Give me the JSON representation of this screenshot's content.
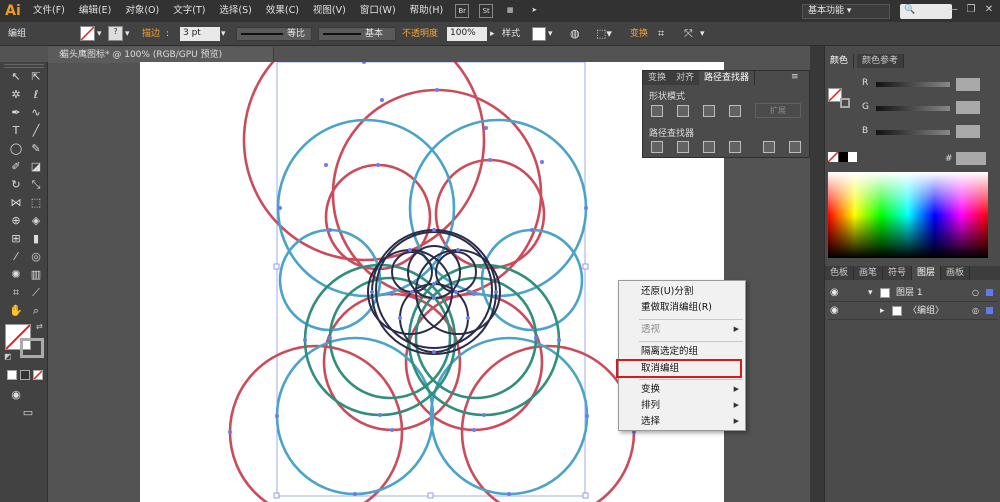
{
  "menubar": {
    "logo": "Ai",
    "items": [
      "文件(F)",
      "编辑(E)",
      "对象(O)",
      "文字(T)",
      "选择(S)",
      "效果(C)",
      "视图(V)",
      "窗口(W)",
      "帮助(H)"
    ],
    "badge": "Br",
    "badge2": "St",
    "workspace": "基本功能",
    "window_buttons": [
      "—",
      "❐",
      "✕"
    ]
  },
  "control_bar": {
    "selection": "编组",
    "stroke_label": "描边",
    "stroke_value": "3 pt",
    "profile_label": "等比",
    "brush_label": "基本",
    "opacity_label": "不透明度",
    "opacity_value": "100%",
    "style_label": "样式",
    "transform_label": "变换"
  },
  "document": {
    "tab_title": "猫头鹰图标* @ 100% (RGB/GPU 预览)",
    "close": "×"
  },
  "pathfinder": {
    "tabs": [
      "变换",
      "对齐",
      "路径查找器"
    ],
    "shape_modes_label": "形状模式",
    "pathfinders_label": "路径查找器",
    "expand_label": "扩展"
  },
  "color_panel": {
    "tabs": [
      "颜色",
      "颜色参考"
    ],
    "channels": [
      "R",
      "G",
      "B"
    ],
    "hex_label": "#"
  },
  "layers_panel": {
    "tabs": [
      "色板",
      "画笔",
      "符号",
      "图层",
      "画板"
    ],
    "rows": [
      {
        "name": "图层 1"
      },
      {
        "name": "〈编组〉"
      }
    ]
  },
  "context_menu": {
    "items": [
      {
        "label": "还原(U)分割",
        "enabled": true,
        "submenu": false
      },
      {
        "label": "重做取消编组(R)",
        "enabled": true,
        "submenu": false
      },
      {
        "label": "透视",
        "enabled": false,
        "submenu": true
      },
      {
        "label": "隔离选定的组",
        "enabled": true,
        "submenu": false
      },
      {
        "label": "取消编组",
        "enabled": true,
        "submenu": false,
        "highlighted": true
      },
      {
        "label": "变换",
        "enabled": true,
        "submenu": true
      },
      {
        "label": "排列",
        "enabled": true,
        "submenu": true
      },
      {
        "label": "选择",
        "enabled": true,
        "submenu": true
      }
    ]
  },
  "colors": {
    "ui_dark": "#323232",
    "ui_mid": "#424242",
    "accent_orange": "#f1a43a",
    "stroke_red": "#cc4b5a",
    "stroke_blue": "#4aa3c8",
    "stroke_green": "#2f8f7a",
    "stroke_navy": "#2b2c4a",
    "anchor_blue": "#6a7df0",
    "highlight_red": "#d81a1a"
  }
}
